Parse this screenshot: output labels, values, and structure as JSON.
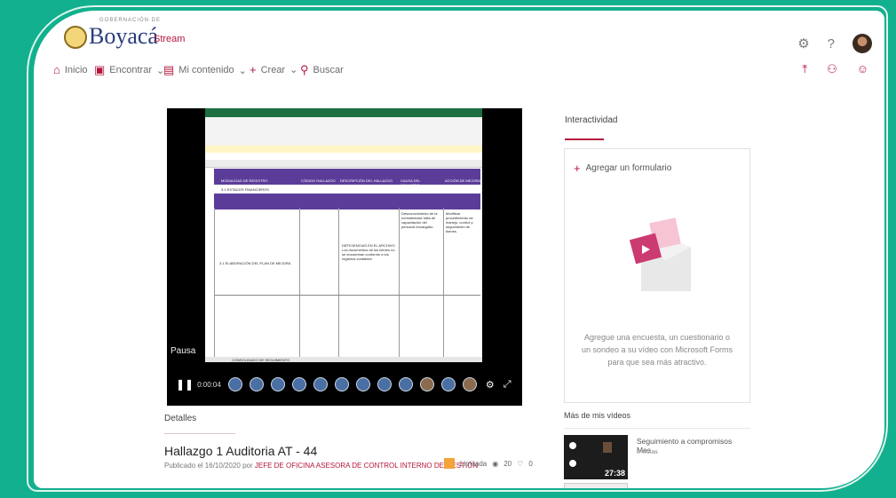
{
  "header": {
    "logo_text": "Boyacá",
    "logo_small": "GOBERNACIÓN DE",
    "app_name": "Stream"
  },
  "nav": {
    "items": [
      {
        "label": "Inicio"
      },
      {
        "label": "Encontrar"
      },
      {
        "label": "Mi contenido"
      },
      {
        "label": "Crear"
      },
      {
        "label": "Buscar"
      }
    ]
  },
  "player": {
    "status_text": "Pausa",
    "time": "0:00:04",
    "sheet_tab": "CONSOLIDADO DE SEGUIMIENTO"
  },
  "spreadsheet": {
    "header_cols": [
      "MODALIDAD DE REGISTRO",
      "CÓDIGO HALLAZGO",
      "DESCRIPCIÓN DEL HALLAZGO",
      "CAUSA DEL HALLAZGO",
      "ACCIÓN DE MEJORA"
    ],
    "row1_text": "3.1 ESTADOS FINANCIEROS",
    "row_label": "3.1 ELABORACIÓN DEL PLAN DE MEJORA",
    "desc_text": "DEFICIENCIAS EN EL ARCHIVO. Los documentos de los bienes no se encuentran conforme a los registros contables.",
    "cause_text": "Desconocimiento de la normatividad; falta de capacitación del personal encargado.",
    "action_text": "Modificar procedimiento de manejo, control y seguimiento de bienes."
  },
  "interactivity": {
    "title": "Interactividad",
    "add_form": "Agregar un formulario",
    "description": "Agregue una encuesta, un cuestionario o un sondeo a su vídeo con Microsoft Forms para que sea más atractivo."
  },
  "details": {
    "tab_label": "Detalles",
    "title": "Hallazgo 1 Auditoria AT - 44",
    "published": "Publicado el 16/10/2020 por",
    "author": "JEFE DE OFICINA ASESORA DE CONTROL INTERNO DE GESTIÓN",
    "visibility": "Limitada",
    "views": "20",
    "likes": "0"
  },
  "more_videos": {
    "title": "Más de mis vídeos",
    "items": [
      {
        "title": "Seguimiento a compromisos Mes...",
        "views": "0 vistas",
        "duration": "27:38"
      }
    ]
  },
  "colors": {
    "accent": "#b4153d",
    "background": "#12b08e"
  }
}
